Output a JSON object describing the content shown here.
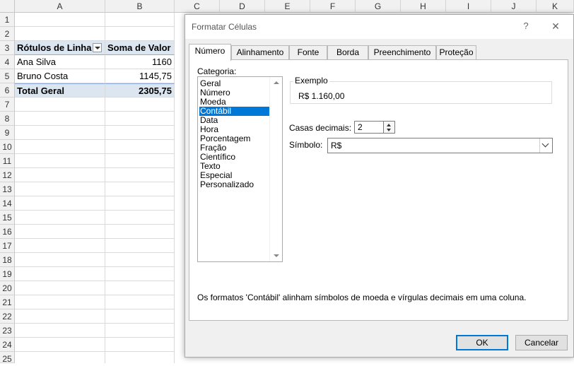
{
  "sheet": {
    "columns": [
      "A",
      "B",
      "C",
      "D",
      "E",
      "F",
      "G",
      "H",
      "I",
      "J",
      "K"
    ],
    "rows": [
      "1",
      "2",
      "3",
      "4",
      "5",
      "6",
      "7",
      "8",
      "9",
      "10",
      "11",
      "12",
      "13",
      "14",
      "15",
      "16",
      "17",
      "18",
      "19",
      "20",
      "21",
      "22",
      "23",
      "24",
      "25"
    ],
    "pivot": {
      "header_rows": "Rótulos de Linha",
      "header_sum": "Soma de Valor",
      "rows": [
        {
          "label": "Ana Silva",
          "value": "1160"
        },
        {
          "label": "Bruno Costa",
          "value": "1145,75"
        }
      ],
      "total_label": "Total Geral",
      "total_value": "2305,75"
    }
  },
  "dialog": {
    "title": "Formatar Células",
    "help": "?",
    "close": "✕",
    "tabs": [
      "Número",
      "Alinhamento",
      "Fonte",
      "Borda",
      "Preenchimento",
      "Proteção"
    ],
    "category_label": "Categoria:",
    "categories": [
      "Geral",
      "Número",
      "Moeda",
      "Contábil",
      "Data",
      "Hora",
      "Porcentagem",
      "Fração",
      "Científico",
      "Texto",
      "Especial",
      "Personalizado"
    ],
    "selected_category": "Contábil",
    "example_label": "Exemplo",
    "example_value": "R$ 1.160,00",
    "decimals_label": "Casas decimais:",
    "decimals_value": "2",
    "symbol_label": "Símbolo:",
    "symbol_value": "R$",
    "description": "Os formatos 'Contábil' alinham símbolos de moeda e vírgulas decimais em uma coluna.",
    "ok": "OK",
    "cancel": "Cancelar"
  },
  "colors": {
    "accent": "#0078d7",
    "pivot_fill": "#dce6f1"
  }
}
